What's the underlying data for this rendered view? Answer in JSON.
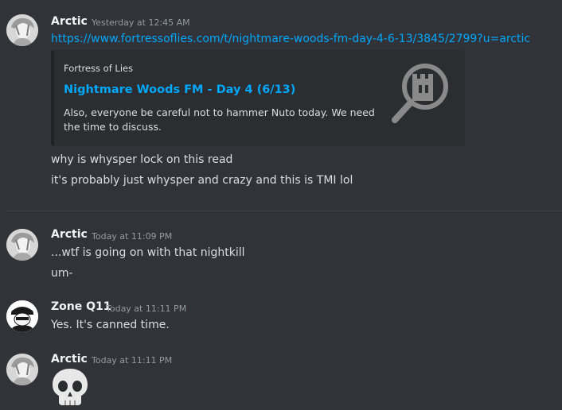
{
  "messages": [
    {
      "author": "Arctic",
      "timestamp": "Yesterday at 12:45 AM",
      "link": "https://www.fortressoflies.com/t/nightmare-woods-fm-day-4-6-13/3845/2799?u=arctic",
      "embed": {
        "provider": "Fortress of Lies",
        "title": "Nightmare Woods FM - Day 4 (6/13)",
        "description": "Also, everyone be careful not to hammer Nuto today. We need the time to discuss.",
        "thumbnail_icon": "fortress-magnifier-icon"
      },
      "lines": [
        "why is whysper lock on this read",
        "it's probably just whysper and crazy and this is TMI lol"
      ]
    },
    {
      "author": "Arctic",
      "timestamp": "Today at 11:09 PM",
      "lines": [
        "...wtf is going on with that nightkill",
        "um-"
      ]
    },
    {
      "author": "Zone Q11",
      "timestamp": "Today at 11:11 PM",
      "lines": [
        "Yes. It's canned time."
      ]
    },
    {
      "author": "Arctic",
      "timestamp": "Today at 11:11 PM",
      "emoji": "skull-icon"
    }
  ],
  "colors": {
    "background": "#313338",
    "link": "#00a8fc",
    "username": "#f2f3f5",
    "timestamp": "#949ba4",
    "embed_bg": "#2b2d31"
  }
}
